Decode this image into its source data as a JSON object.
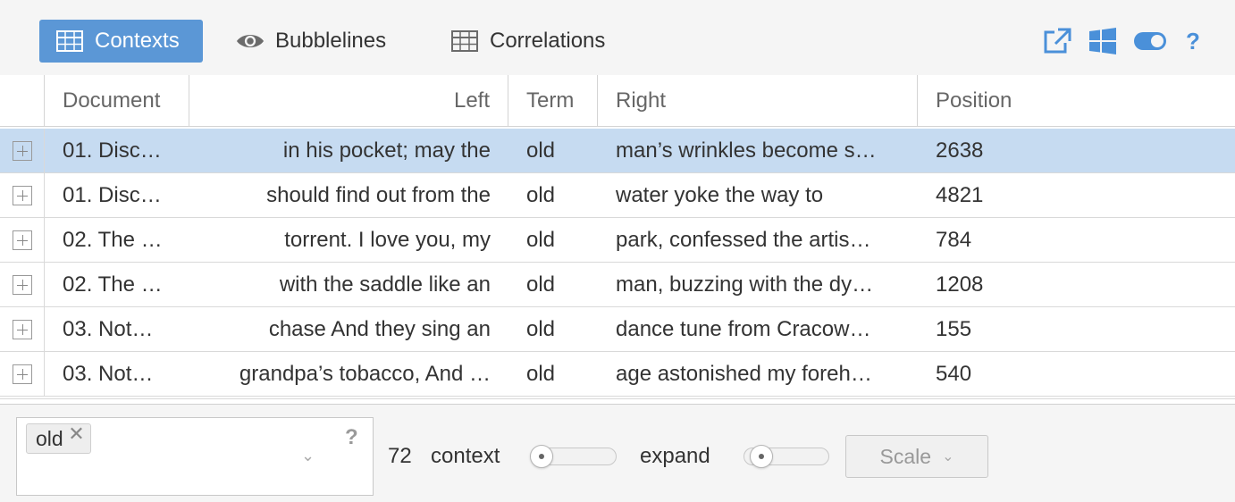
{
  "tabs": {
    "contexts": "Contexts",
    "bubblelines": "Bubblelines",
    "correlations": "Correlations"
  },
  "toolbar_icons": [
    "export-icon",
    "windows-icon",
    "toggle-icon",
    "help-icon"
  ],
  "toolbar": {
    "help_glyph": "?"
  },
  "grid": {
    "headers": {
      "document": "Document",
      "left": "Left",
      "term": "Term",
      "right": "Right",
      "position": "Position"
    },
    "rows": [
      {
        "document": "01. Disc…",
        "left": "in his pocket; may the",
        "term": "old",
        "right": "man’s wrinkles become s…",
        "position": "2638"
      },
      {
        "document": "01. Disc…",
        "left": "should find out from the",
        "term": "old",
        "right": "water yoke the way to",
        "position": "4821"
      },
      {
        "document": "02. The …",
        "left": "torrent. I love you, my",
        "term": "old",
        "right": "park, confessed the artis…",
        "position": "784"
      },
      {
        "document": "02. The …",
        "left": "with the saddle like an",
        "term": "old",
        "right": "man, buzzing with the dy…",
        "position": "1208"
      },
      {
        "document": "03. Not…",
        "left": "chase And they sing an",
        "term": "old",
        "right": "dance tune from Cracow…",
        "position": "155"
      },
      {
        "document": "03. Not…",
        "left": "grandpa’s tobacco, And …",
        "term": "old",
        "right": "age astonished my foreh…",
        "position": "540"
      }
    ]
  },
  "footer": {
    "term_chip": "old",
    "chip_remove": "✕",
    "dropdown_glyph": "⌄",
    "help_glyph": "?",
    "total_count": "72",
    "context_label": "context",
    "expand_label": "expand",
    "scale_label": "Scale",
    "scale_chevron": "⌄"
  },
  "colors": {
    "accent": "#5b97d6",
    "icon_blue": "#4a90d9",
    "selected_row": "#c6dbf1",
    "toolbar_bg": "#f5f5f5"
  }
}
